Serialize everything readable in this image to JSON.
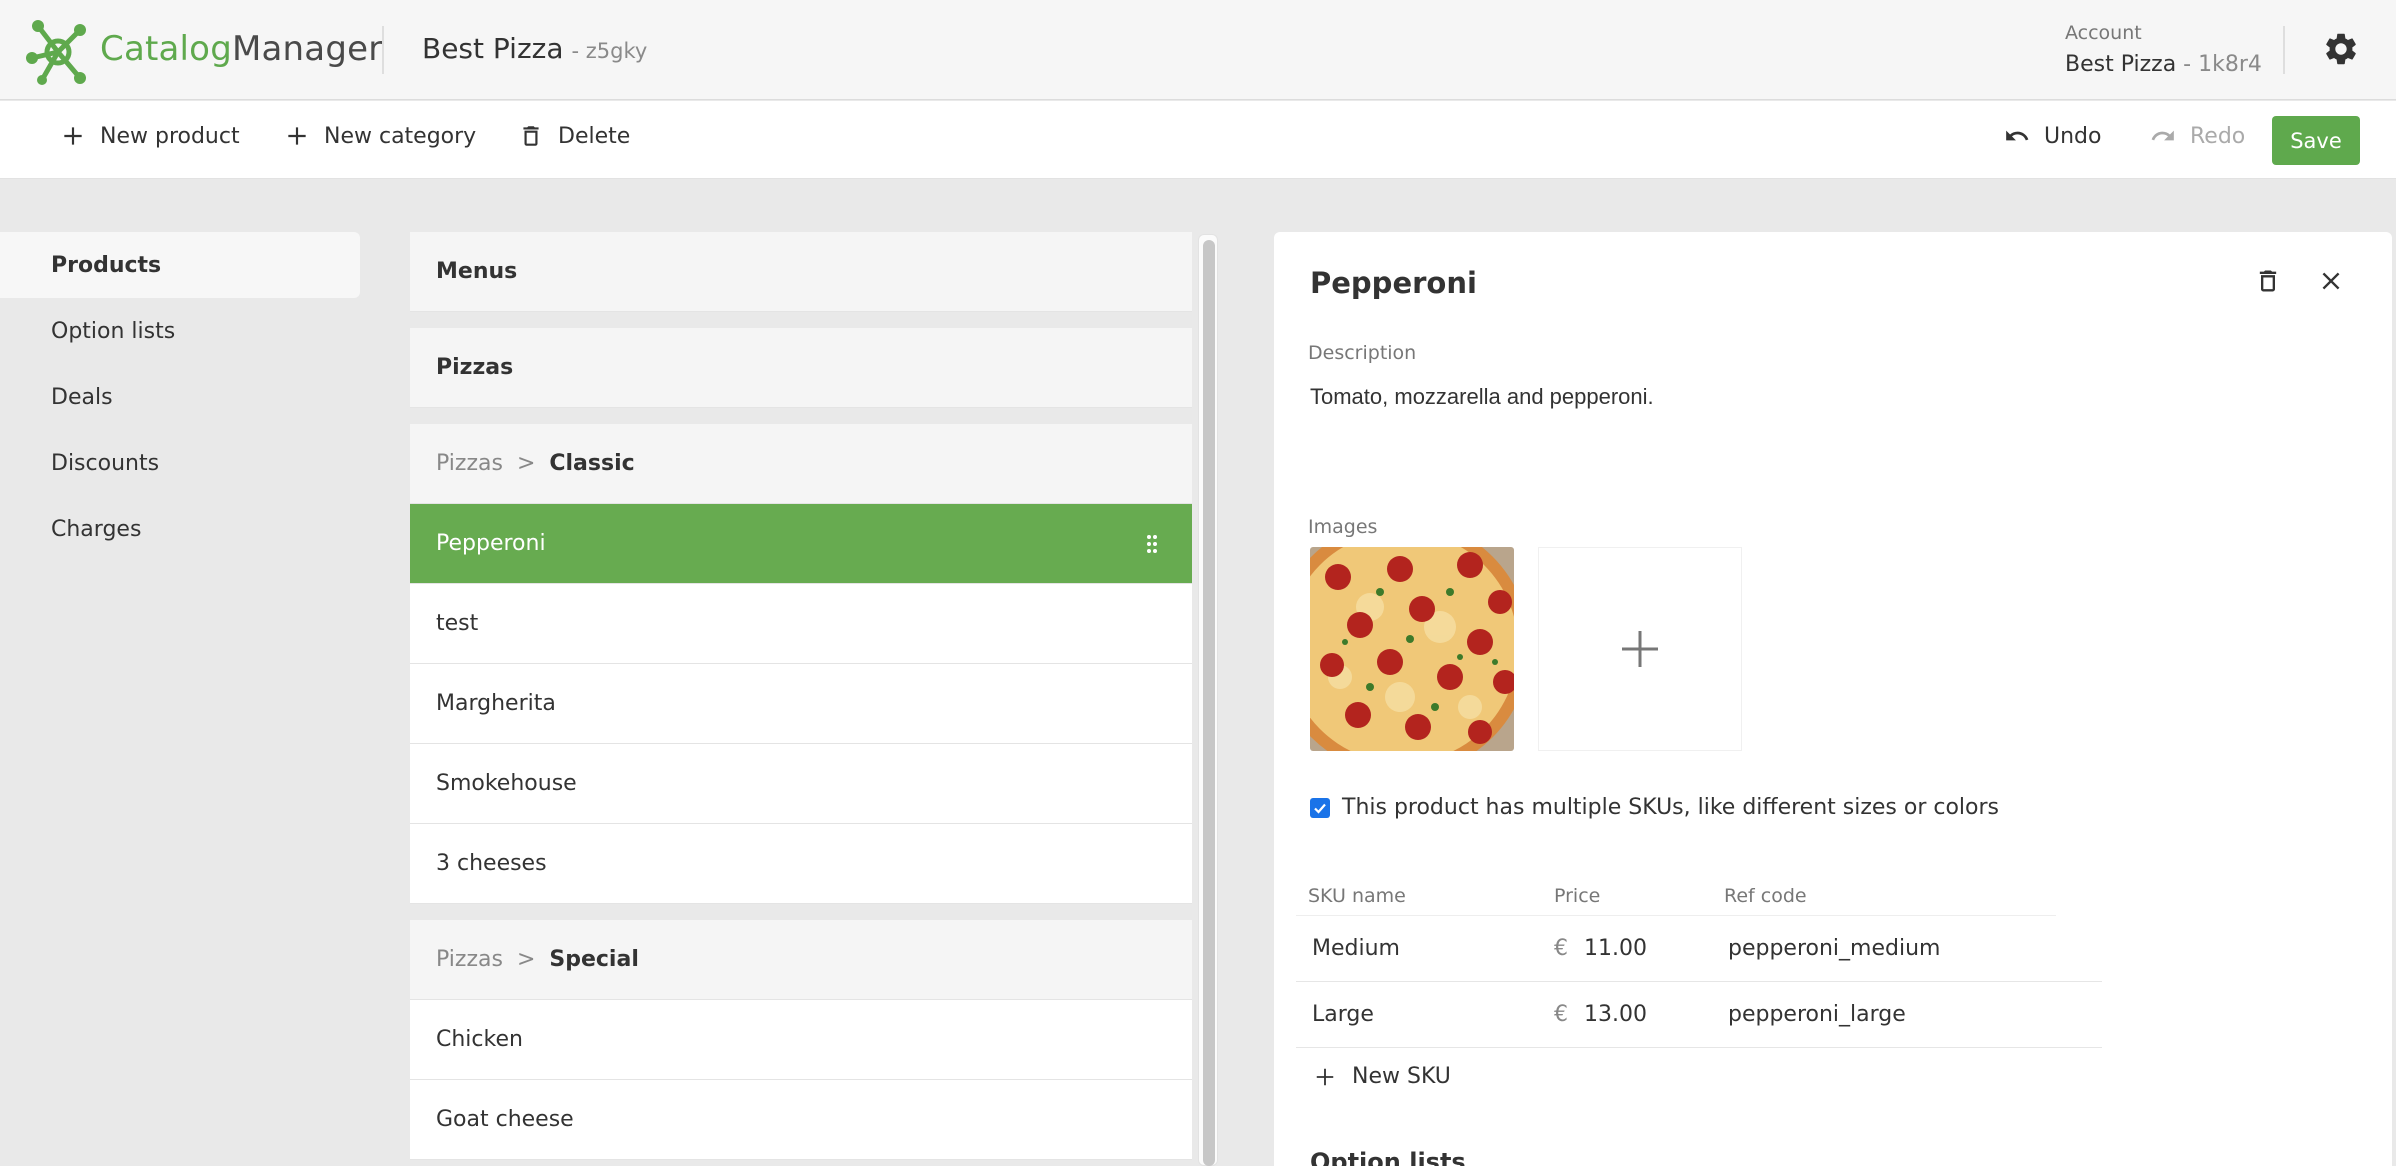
{
  "header": {
    "logo_part1": "Catalog",
    "logo_part2": "Manager",
    "store_name": "Best Pizza",
    "store_code": "- z5gky",
    "account_label": "Account",
    "account_name": "Best Pizza",
    "account_code": " - 1k8r4"
  },
  "toolbar": {
    "new_product": "New product",
    "new_category": "New category",
    "delete": "Delete",
    "undo": "Undo",
    "redo": "Redo",
    "save": "Save"
  },
  "nav": {
    "items": [
      {
        "label": "Products",
        "active": true
      },
      {
        "label": "Option lists"
      },
      {
        "label": "Deals"
      },
      {
        "label": "Discounts"
      },
      {
        "label": "Charges"
      }
    ]
  },
  "catalog": {
    "menus": "Menus",
    "pizzas": "Pizzas",
    "classic": {
      "parent": "Pizzas",
      "separator": ">",
      "name": "Classic",
      "products": [
        "Pepperoni",
        "test",
        "Margherita",
        "Smokehouse",
        "3 cheeses"
      ]
    },
    "special": {
      "parent": "Pizzas",
      "separator": ">",
      "name": "Special",
      "products": [
        "Chicken",
        "Goat cheese"
      ]
    }
  },
  "detail": {
    "title": "Pepperoni",
    "description_label": "Description",
    "description": "Tomato, mozzarella and pepperoni.",
    "images_label": "Images",
    "multiple_skus_label": "This product has multiple SKUs, like different sizes or colors",
    "multiple_skus_checked": true,
    "sku_columns": {
      "name": "SKU name",
      "price": "Price",
      "ref": "Ref code"
    },
    "skus": [
      {
        "name": "Medium",
        "currency": "€",
        "price": "11.00",
        "ref": "pepperoni_medium"
      },
      {
        "name": "Large",
        "currency": "€",
        "price": "13.00",
        "ref": "pepperoni_large"
      }
    ],
    "new_sku": "New SKU",
    "option_lists_heading": "Option lists"
  },
  "colors": {
    "brand_green": "#5fa94d",
    "selected_row": "#67ab50",
    "checkbox_blue": "#1a73e8"
  }
}
